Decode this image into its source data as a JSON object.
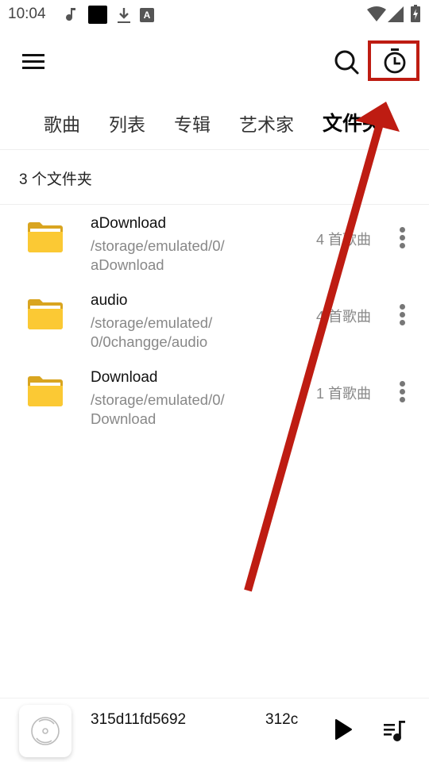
{
  "status_bar": {
    "time": "10:04",
    "notification_icons": [
      "music-note-icon",
      "black-square-icon",
      "download-icon",
      "font-a-icon"
    ],
    "system_icons": [
      "wifi-icon",
      "cellular-signal-icon",
      "battery-charging-icon"
    ]
  },
  "app_bar": {
    "menu_icon": "hamburger-menu-icon",
    "search_icon": "search-icon",
    "timer_icon": "sleep-timer-icon"
  },
  "tabs": [
    {
      "label": "歌曲",
      "active": false
    },
    {
      "label": "列表",
      "active": false
    },
    {
      "label": "专辑",
      "active": false
    },
    {
      "label": "艺术家",
      "active": false
    },
    {
      "label": "文件夹",
      "active": true
    }
  ],
  "folder_count_label": "3 个文件夹",
  "folders": [
    {
      "name": "aDownload",
      "path_line1": "/storage/emulated/0/",
      "path_line2": "aDownload",
      "song_count": "4 首歌曲"
    },
    {
      "name": "audio",
      "path_line1": "/storage/emulated/",
      "path_line2": "0/0changge/audio",
      "song_count": "4 首歌曲"
    },
    {
      "name": "Download",
      "path_line1": "/storage/emulated/0/",
      "path_line2": "Download",
      "song_count": "1 首歌曲"
    }
  ],
  "now_playing": {
    "title": "315d11fd5692",
    "extra": "312c",
    "play_icon": "play-icon",
    "queue_icon": "queue-music-icon",
    "album_art_icon": "disc-icon"
  },
  "colors": {
    "folder": "#FBC934",
    "folder_tab": "#D9A520",
    "annotation": "#BE1C12"
  }
}
